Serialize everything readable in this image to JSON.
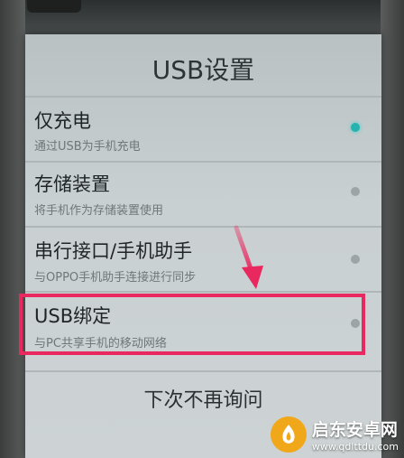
{
  "dialog": {
    "title": "USB设置",
    "options": [
      {
        "label": "仅充电",
        "description": "通过USB为手机充电",
        "selected": true
      },
      {
        "label": "存储装置",
        "description": "将手机作为存储装置使用",
        "selected": false
      },
      {
        "label": "串行接口/手机助手",
        "description": "与OPPO手机助手连接进行同步",
        "selected": false
      },
      {
        "label": "USB绑定",
        "description": "与PC共享手机的移动网络",
        "selected": false
      }
    ],
    "cancel_label": "下次不再询问"
  },
  "annotation": {
    "highlight_color": "#e8285e",
    "highlighted_option": "USB绑定"
  },
  "watermark": {
    "name": "启东安卓网",
    "url": "www.qdlttdu.com"
  },
  "colors": {
    "selected_radio": "#26b3b0",
    "dialog_bg": "#c9d0d2"
  }
}
